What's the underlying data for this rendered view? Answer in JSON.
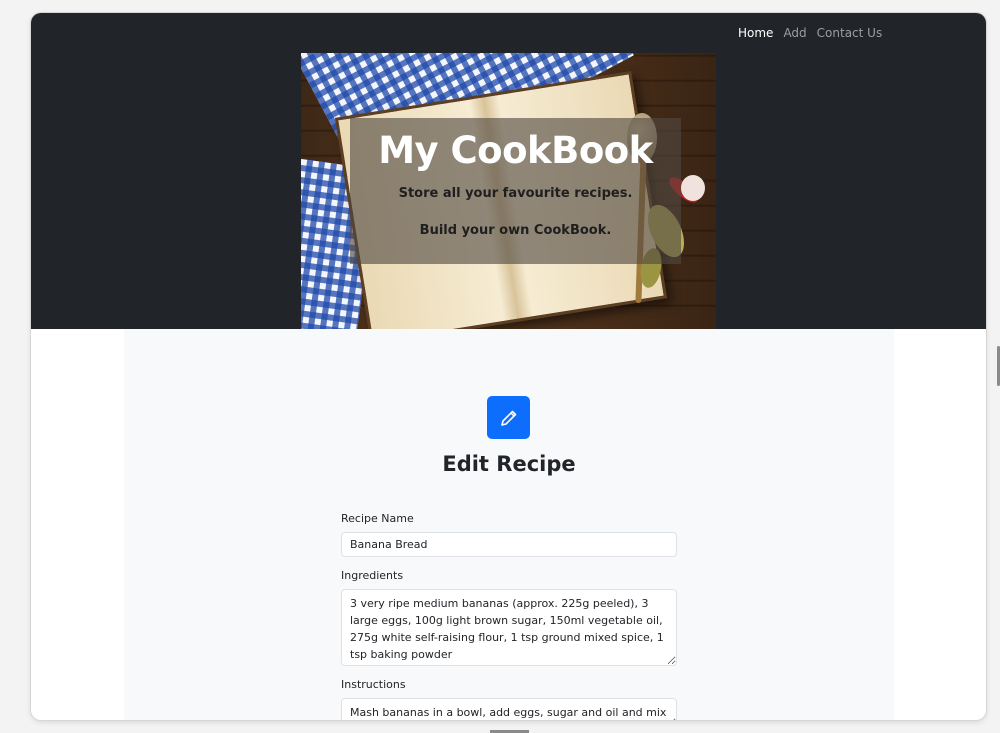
{
  "nav": {
    "items": [
      {
        "label": "Home",
        "active": true
      },
      {
        "label": "Add",
        "active": false
      },
      {
        "label": "Contact Us",
        "active": false
      }
    ]
  },
  "hero": {
    "title": "My CookBook",
    "subtitle1": "Store all your favourite recipes.",
    "subtitle2": "Build your own CookBook."
  },
  "main": {
    "icon": "pencil-icon",
    "title": "Edit Recipe"
  },
  "form": {
    "recipe_name_label": "Recipe Name",
    "recipe_name_value": "Banana Bread",
    "ingredients_label": "Ingredients",
    "ingredients_value": "3 very ripe medium bananas (approx. 225g peeled), 3 large eggs, 100g light brown sugar, 150ml vegetable oil, 275g white self-raising flour, 1 tsp ground mixed spice, 1 tsp baking powder",
    "instructions_label": "Instructions",
    "instructions_value": "Mash bananas in a bowl, add eggs, sugar and oil and mix with"
  },
  "colors": {
    "header_bg": "#212529",
    "accent": "#0d6efd",
    "main_bg": "#f8f9fa"
  }
}
